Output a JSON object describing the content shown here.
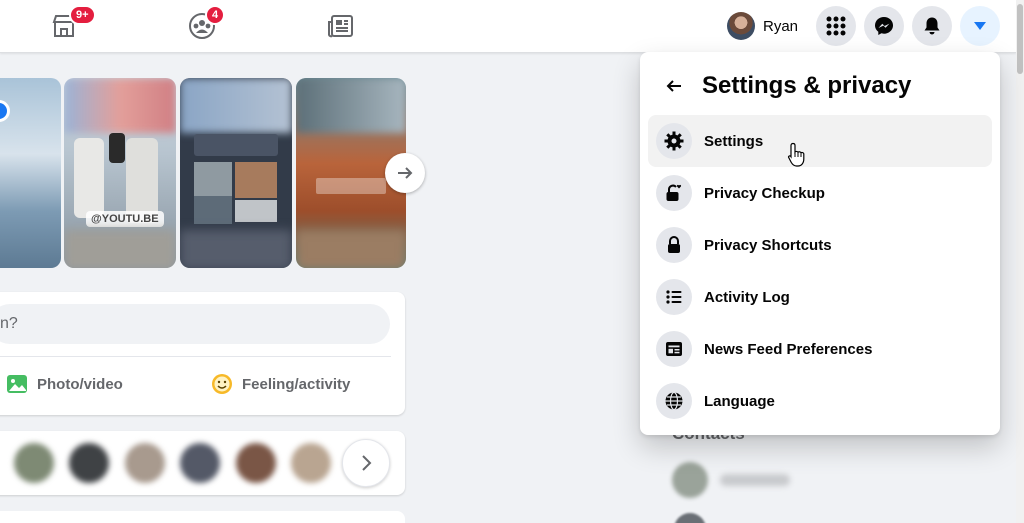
{
  "topnav": {
    "marketplace_badge": "9+",
    "groups_badge": "4",
    "profile_name": "Ryan"
  },
  "stories": {
    "youtu_label": "@YOUTU.BE"
  },
  "composer": {
    "placeholder_fragment": "n?",
    "photo_label": "Photo/video",
    "feeling_label": "Feeling/activity"
  },
  "sidebar": {
    "contacts_label": "Contacts"
  },
  "settings_menu": {
    "title": "Settings & privacy",
    "items": [
      {
        "label": "Settings",
        "icon": "gear-icon"
      },
      {
        "label": "Privacy Checkup",
        "icon": "lock-heart-icon"
      },
      {
        "label": "Privacy Shortcuts",
        "icon": "lock-icon"
      },
      {
        "label": "Activity Log",
        "icon": "list-icon"
      },
      {
        "label": "News Feed Preferences",
        "icon": "news-feed-icon"
      },
      {
        "label": "Language",
        "icon": "globe-icon"
      }
    ]
  },
  "colors": {
    "accent": "#1877f2",
    "badge": "#e41e3f",
    "background": "#f0f2f5"
  }
}
